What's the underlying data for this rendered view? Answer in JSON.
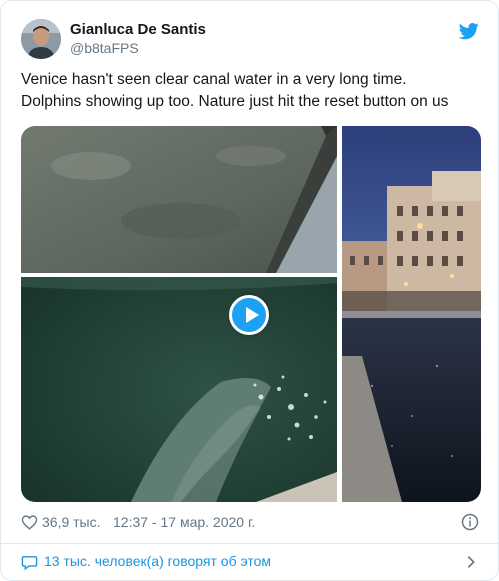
{
  "author": {
    "display_name": "Gianluca De Santis",
    "handle": "@b8taFPS"
  },
  "tweet": {
    "text_lines": [
      "Venice hasn't seen clear canal water in a very long time.",
      "Dolphins showing up too. Nature just hit the reset button on us"
    ]
  },
  "media": {
    "tiles": [
      "canal-water-photo",
      "dolphin-video",
      "canal-night-photo"
    ],
    "play_icon": "play-icon"
  },
  "meta": {
    "likes": "36,9 тыс.",
    "timestamp": "12:37 - 17 мар. 2020 г."
  },
  "footer": {
    "people_talking": "13 тыс. человек(а) говорят об этом"
  },
  "colors": {
    "accent": "#1da1f2",
    "link": "#1b95e0",
    "secondary_text": "#657786",
    "border": "#e1e8ed"
  },
  "icons": [
    "twitter-bird-icon",
    "heart-icon",
    "info-icon",
    "comment-icon",
    "chevron-right-icon"
  ]
}
